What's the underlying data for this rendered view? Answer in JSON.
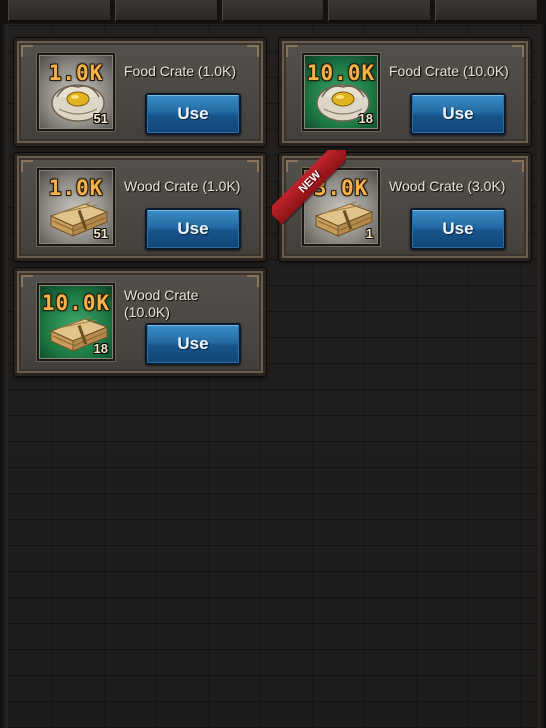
{
  "tabs": [
    "",
    "",
    "",
    "",
    ""
  ],
  "items": [
    {
      "amount": "1.0K",
      "name": "Food Crate (1.0K)",
      "count": "51",
      "button": "Use",
      "type": "food",
      "frame": "gray",
      "is_new": false
    },
    {
      "amount": "10.0K",
      "name": "Food Crate (10.0K)",
      "count": "18",
      "button": "Use",
      "type": "food",
      "frame": "green",
      "is_new": false
    },
    {
      "amount": "1.0K",
      "name": "Wood Crate (1.0K)",
      "count": "51",
      "button": "Use",
      "type": "wood",
      "frame": "gray",
      "is_new": false
    },
    {
      "amount": "3.0K",
      "name": "Wood Crate (3.0K)",
      "count": "1",
      "button": "Use",
      "type": "wood",
      "frame": "gray",
      "is_new": true,
      "new_label": "NEW"
    },
    {
      "amount": "10.0K",
      "name": "Wood Crate (10.0K)",
      "count": "18",
      "button": "Use",
      "type": "wood",
      "frame": "green",
      "is_new": false
    }
  ],
  "colors": {
    "amount_text": "#f4b24a",
    "button": "#226aa4",
    "new_ribbon": "#c0242a",
    "gray_frame": "#8f8c86",
    "green_frame": "#1d7a45"
  },
  "icons": {
    "food": "food-sack-icon",
    "wood": "wood-planks-icon"
  }
}
